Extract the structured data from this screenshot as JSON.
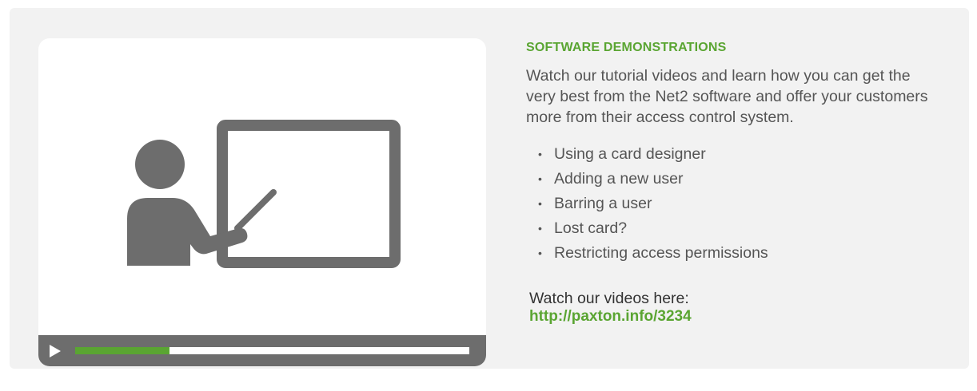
{
  "section": {
    "heading": "SOFTWARE DEMONSTRATIONS",
    "intro": "Watch our tutorial videos and learn how you can get the very best from the Net2 software and offer your customers more from their access control system.",
    "topics": [
      "Using a card designer",
      "Adding a new user",
      "Barring a user",
      "Lost card?",
      "Restricting access permissions"
    ],
    "cta_label": "Watch our videos here:",
    "cta_link_text": "http://paxton.info/3234"
  },
  "video": {
    "illustration_icon": "presenter-whiteboard-icon",
    "play_icon": "play-icon",
    "progress_fraction": 0.24
  },
  "colors": {
    "accent_green": "#5aa532",
    "icon_gray": "#6d6d6d",
    "text_gray": "#555555",
    "panel_background": "#f2f2f2"
  }
}
